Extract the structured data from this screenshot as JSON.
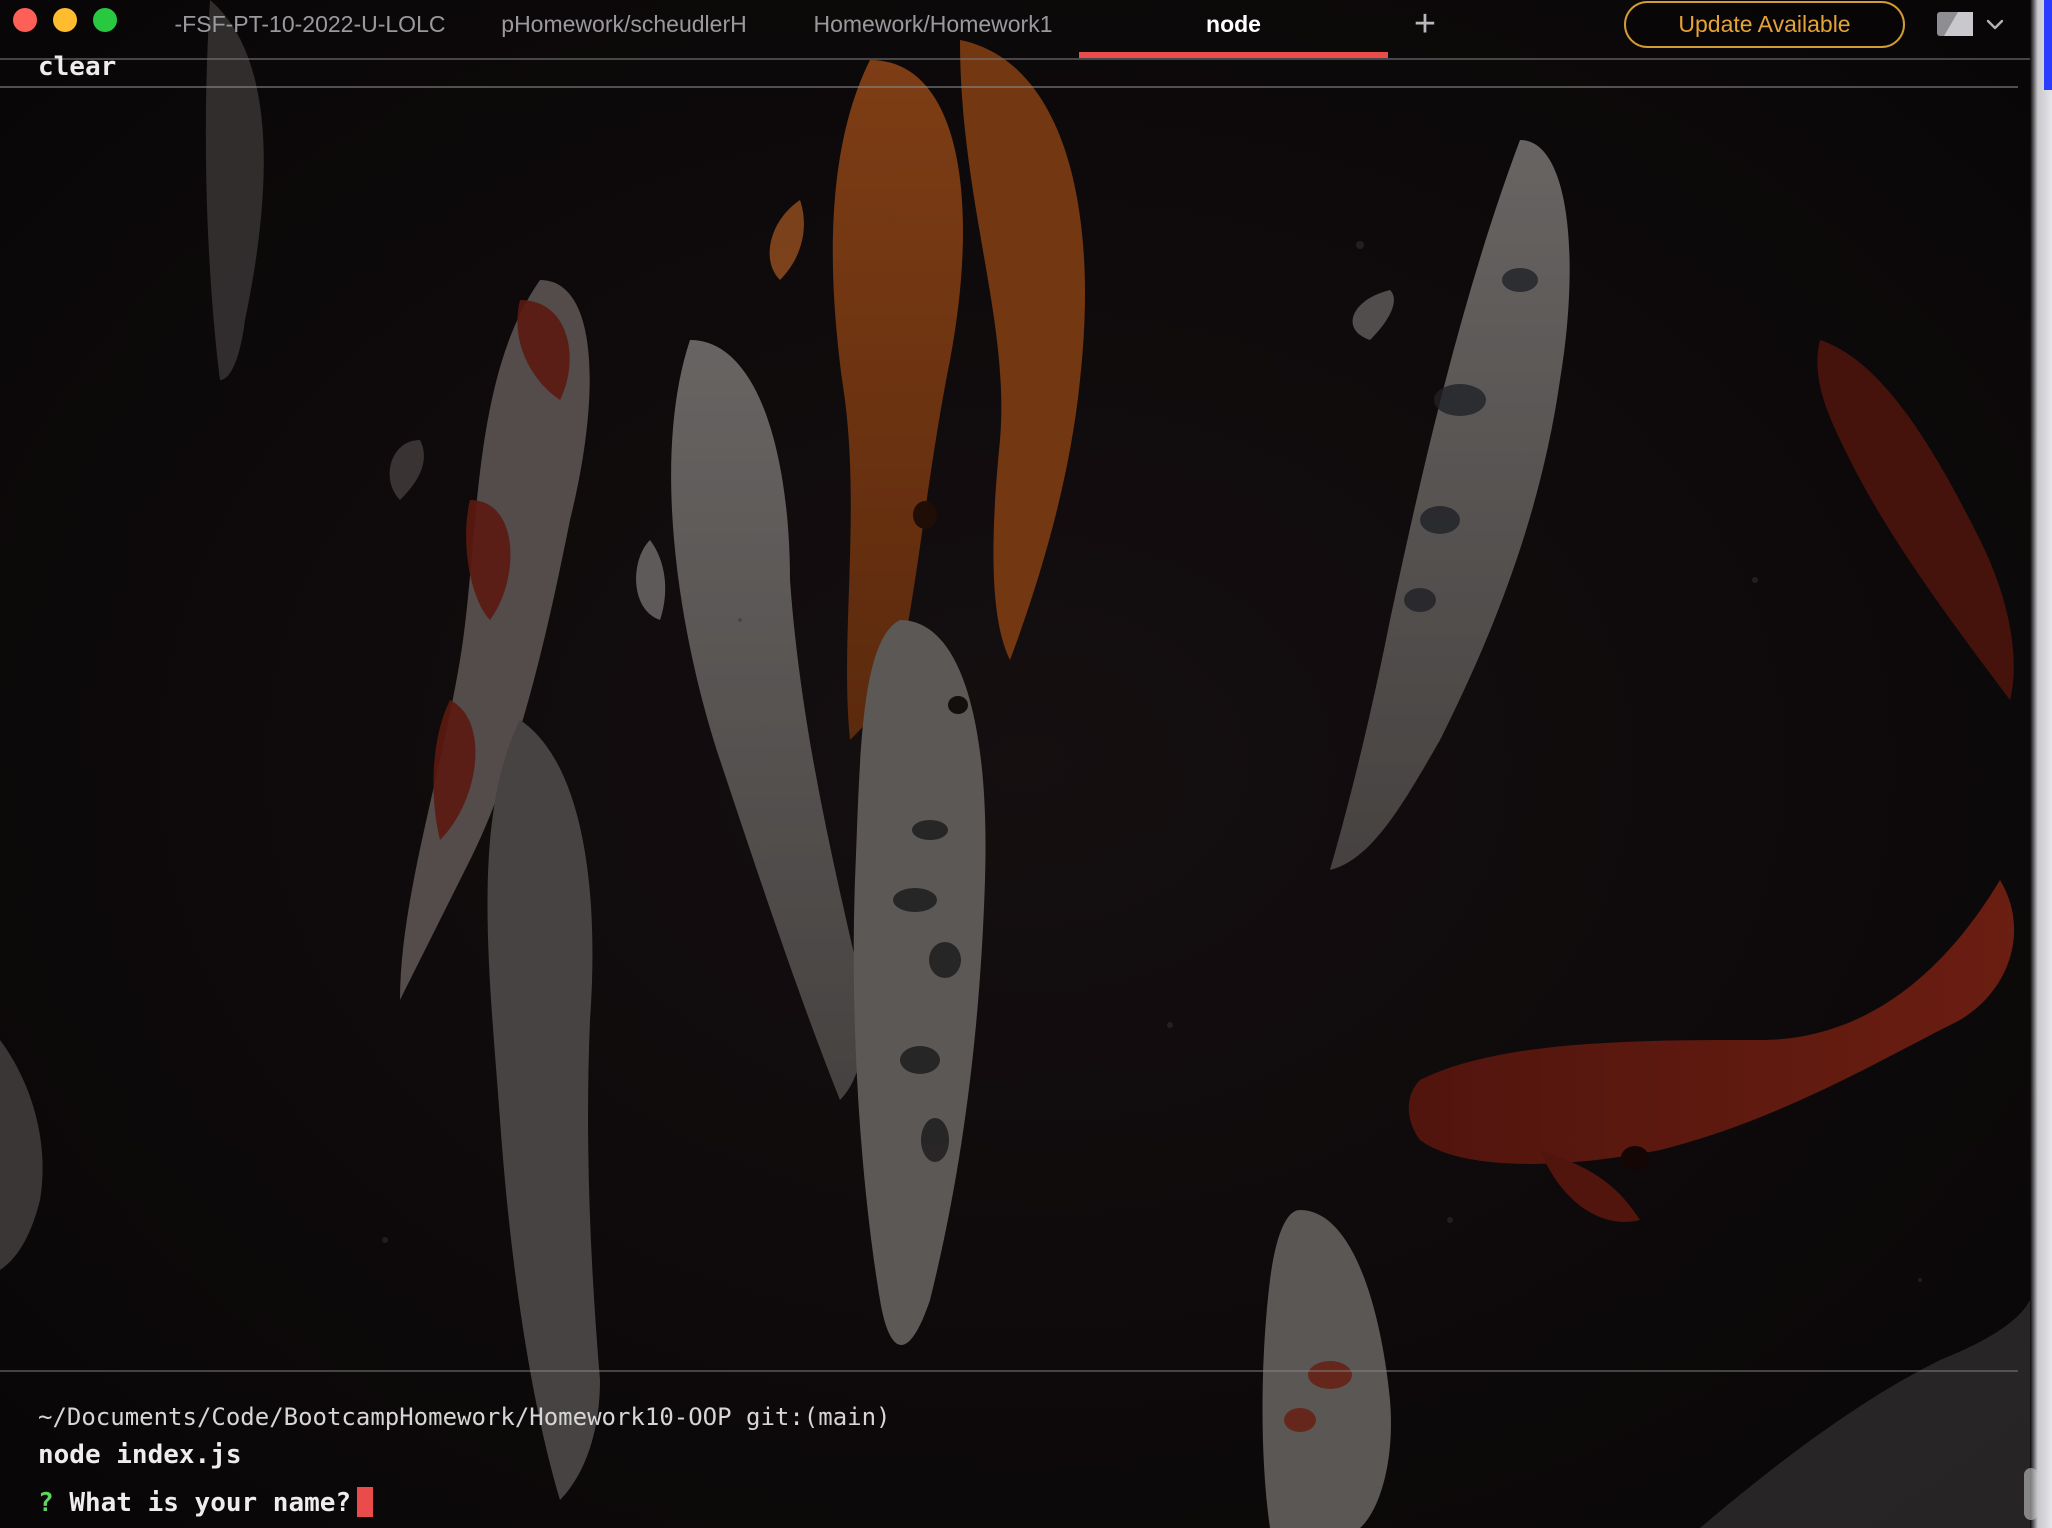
{
  "window": {
    "traffic_lights": [
      "close",
      "minimize",
      "zoom"
    ],
    "colors": {
      "close": "#fe5f57",
      "minimize": "#febc2e",
      "zoom": "#28c840",
      "active_tab_underline": "#ea4b4b",
      "update_accent": "#e4a336",
      "prompt_mark": "#5fd35f",
      "cursor": "#ea4b4b"
    }
  },
  "tabs": [
    {
      "label": "-FSF-PT-10-2022-U-LOLC",
      "active": false
    },
    {
      "label": "pHomework/scheudlerH",
      "active": false
    },
    {
      "label": "Homework/Homework1",
      "active": false
    },
    {
      "label": "node",
      "active": true
    }
  ],
  "toolbar": {
    "new_tab_icon": "plus-icon",
    "update_label": "Update Available",
    "layout_icon": "split-pane-icon",
    "layout_menu_icon": "chevron-down-icon"
  },
  "terminal": {
    "previous_command": "clear",
    "cwd_line": "~/Documents/Code/BootcampHomework/Homework10-OOP git:(main)",
    "current_command": "node index.js",
    "prompt_mark": "?",
    "prompt_question": "What is your name?"
  }
}
